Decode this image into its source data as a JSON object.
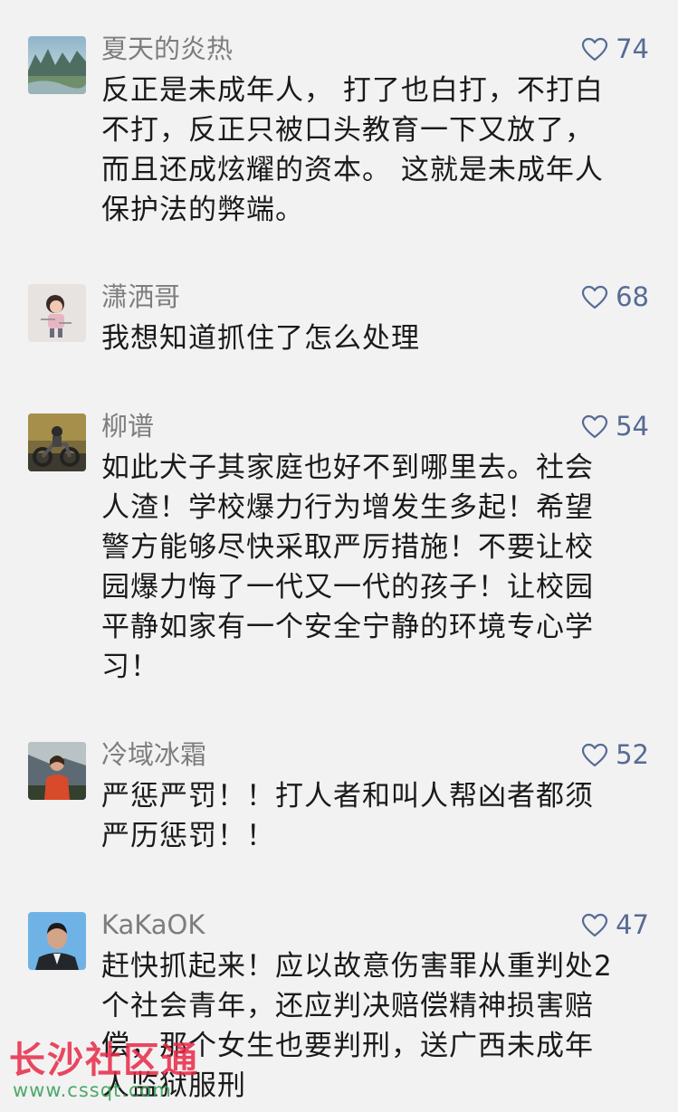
{
  "comments": [
    {
      "user": "夏天的炎热",
      "likes": "74",
      "lines": [
        "反正是未成年人， 打了也白打，不打白",
        "不打，反正只被口头教育一下又放了，",
        "而且还成炫耀的资本。 这就是未成年人",
        "保护法的弊端。"
      ]
    },
    {
      "user": "潇洒哥",
      "likes": "68",
      "lines": [
        "我想知道抓住了怎么处理"
      ]
    },
    {
      "user": "柳谱",
      "likes": "54",
      "lines": [
        "如此犬子其家庭也好不到哪里去。社会",
        "人渣！学校爆力行为增发生多起！希望",
        "警方能够尽快采取严厉措施！不要让校",
        "园爆力悔了一代又一代的孩子！让校园",
        "平静如家有一个安全宁静的环境专心学",
        "习！"
      ]
    },
    {
      "user": "冷域冰霜",
      "likes": "52",
      "lines": [
        "严惩严罚！！打人者和叫人帮凶者都须",
        "严历惩罚！！"
      ]
    },
    {
      "user": "KaKaOK",
      "likes": "47",
      "lines": [
        "赶快抓起来！应以故意伤害罪从重判处2",
        "个社会青年，还应判决赔偿精神损害赔",
        "偿，那个女生也要判刑，送广西未成年",
        "人监狱服刑"
      ]
    }
  ],
  "watermark": {
    "title": "长沙社区通",
    "url": "www.cssqt.com"
  },
  "colors": {
    "background": "#f2f2f2",
    "username": "#7d7d7d",
    "like": "#576b95",
    "text": "#1a1a1a"
  },
  "icons": {
    "like": "heart-outline-icon"
  }
}
